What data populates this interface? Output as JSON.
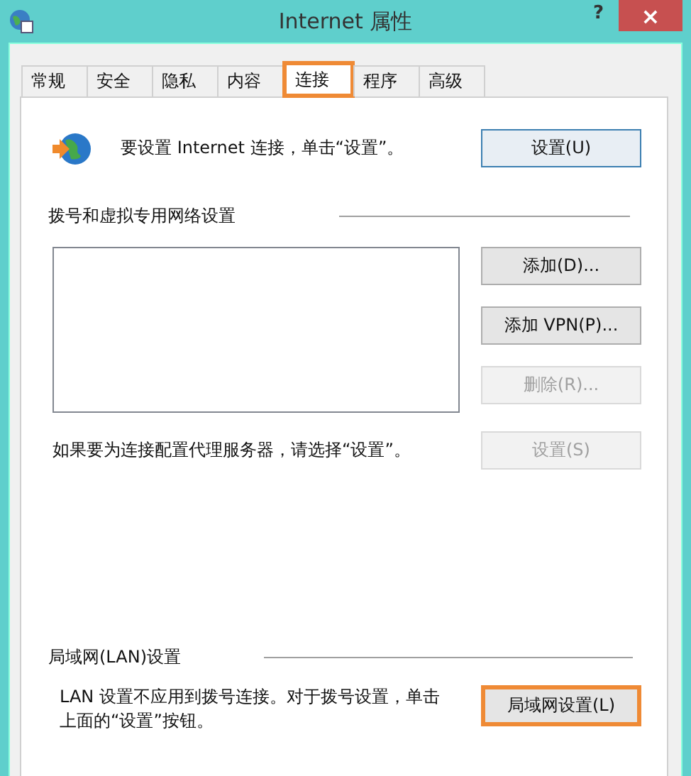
{
  "window": {
    "title": "Internet 属性",
    "help": "?",
    "close": "×"
  },
  "tabs": [
    {
      "label": "常规",
      "selected": false,
      "highlighted": false
    },
    {
      "label": "安全",
      "selected": false,
      "highlighted": false
    },
    {
      "label": "隐私",
      "selected": false,
      "highlighted": false
    },
    {
      "label": "内容",
      "selected": false,
      "highlighted": false
    },
    {
      "label": "连接",
      "selected": true,
      "highlighted": true
    },
    {
      "label": "程序",
      "selected": false,
      "highlighted": false
    },
    {
      "label": "高级",
      "selected": false,
      "highlighted": false
    }
  ],
  "setup": {
    "text": "要设置 Internet 连接，单击“设置”。",
    "button": "设置(U)"
  },
  "dialup": {
    "heading": "拨号和虚拟专用网络设置",
    "buttons": [
      {
        "label": "添加(D)...",
        "disabled": false
      },
      {
        "label": "添加 VPN(P)...",
        "disabled": false
      },
      {
        "label": "删除(R)...",
        "disabled": true
      }
    ],
    "proxy_text": "如果要为连接配置代理服务器，请选择“设置”。",
    "proxy_button": {
      "label": "设置(S)",
      "disabled": true
    }
  },
  "lan": {
    "heading": "局域网(LAN)设置",
    "text": "LAN 设置不应用到拨号连接。对于拨号设置，单击上面的“设置”按钮。",
    "button": {
      "label": "局域网设置(L)",
      "disabled": false,
      "highlighted": true
    }
  }
}
